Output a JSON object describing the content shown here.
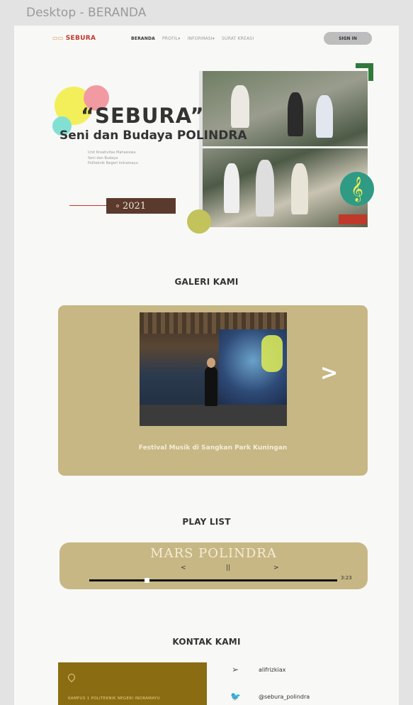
{
  "frame_label": "Desktop - BERANDA",
  "nav": {
    "logo": "SEBURA",
    "links": [
      "BERANDA",
      "PROFIL▾",
      "INFORMASI▾",
      "SURAT KREASI"
    ],
    "signin": "SIGN IN"
  },
  "hero": {
    "title": "“SEBURA”",
    "subtitle": "Seni dan Budaya POLINDRA",
    "desc_lines": [
      "Unit Kreativitas Mahasiswa",
      "Seni dan Budaya",
      "Politeknik Negeri Indramayu"
    ],
    "year": "2021"
  },
  "gallery": {
    "title": "GALERI KAMI",
    "caption": "Festival Musik di Sangkan Park Kuningan",
    "next_icon": ">"
  },
  "playlist": {
    "title": "PLAY LIST",
    "song": "MARS POLINDRA",
    "prev": "<",
    "pause": "||",
    "next": ">",
    "duration": "3:23",
    "progress": 0.23
  },
  "contact": {
    "title": "KONTAK KAMI",
    "campus": "KAMPUS 1 POLITEKNIK NEGERI INDRAMAYU",
    "social": [
      {
        "icon": "send-icon",
        "text": "alifrizkiax"
      },
      {
        "icon": "twitter-icon",
        "text": "@sebura_polindra"
      }
    ]
  },
  "colors": {
    "accent_gold": "#c7b784",
    "brand_red": "#c0392b",
    "contact_card": "#8a6c12"
  }
}
